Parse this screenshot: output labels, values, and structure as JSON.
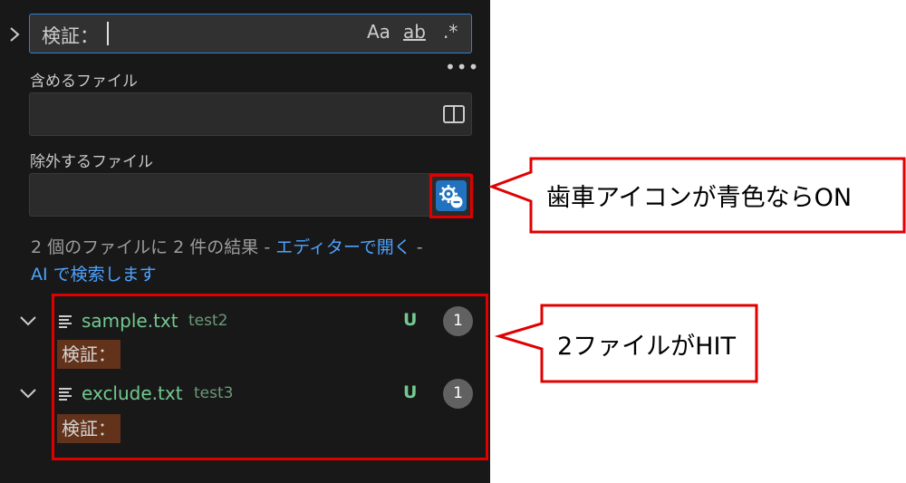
{
  "search": {
    "query": "検証：",
    "match_case_label": "Aa",
    "whole_word_label": "ab",
    "regex_label": ".*"
  },
  "more_label": "•••",
  "include": {
    "label": "含めるファイル",
    "value": ""
  },
  "exclude": {
    "label": "除外するファイル",
    "value": ""
  },
  "summary": {
    "prefix": "2 個のファイルに 2 件の結果 - ",
    "open_editor": "エディターで開く",
    "dash": " -",
    "ai_search": "AI で検索します"
  },
  "results": [
    {
      "file": "sample.txt",
      "path": "test2",
      "status": "U",
      "count": "1",
      "match": "検証："
    },
    {
      "file": "exclude.txt",
      "path": "test3",
      "status": "U",
      "count": "1",
      "match": "検証："
    }
  ],
  "callouts": {
    "gear_note": "歯車アイコンが青色ならON",
    "hit_note": "2ファイルがHIT"
  },
  "colors": {
    "accent_blue": "#2173c0",
    "link": "#4da3ff",
    "file_green": "#73c991",
    "match_bg": "#62331a",
    "annotation_red": "#e00000"
  }
}
